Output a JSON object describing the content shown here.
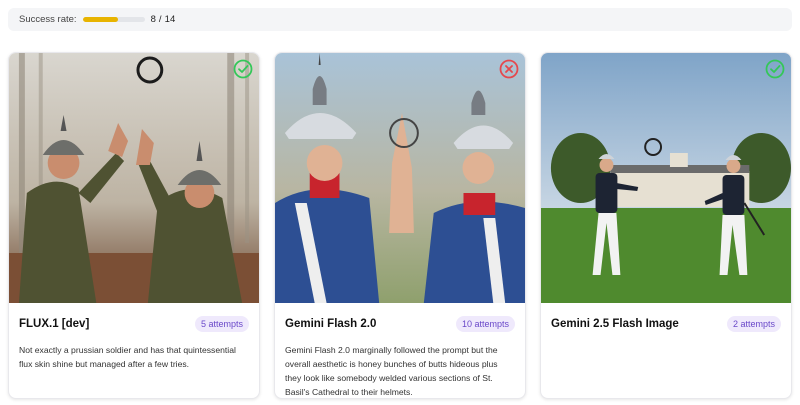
{
  "status": {
    "label": "Success rate:",
    "count": "8 / 14",
    "progress_fraction": 0.57,
    "bar_color": "#e8b400"
  },
  "cards": [
    {
      "model": "FLUX.1 [dev]",
      "attempts": "5 attempts",
      "result": "success",
      "result_icon": "check-circle-icon",
      "result_color": "#34c759",
      "comment": "Not exactly a prussian soldier and has that quintessential flux skin shine but managed after a few tries."
    },
    {
      "model": "Gemini Flash 2.0",
      "attempts": "10 attempts",
      "result": "failure",
      "result_icon": "x-circle-icon",
      "result_color": "#e5484d",
      "comment": "Gemini Flash 2.0 marginally followed the prompt but the overall aesthetic is honey bunches of butts hideous plus they look like somebody welded various sections of St. Basil's Cathedral to their helmets."
    },
    {
      "model": "Gemini 2.5 Flash Image",
      "attempts": "2 attempts",
      "result": "success",
      "result_icon": "check-circle-icon",
      "result_color": "#34c759",
      "comment": ""
    }
  ]
}
